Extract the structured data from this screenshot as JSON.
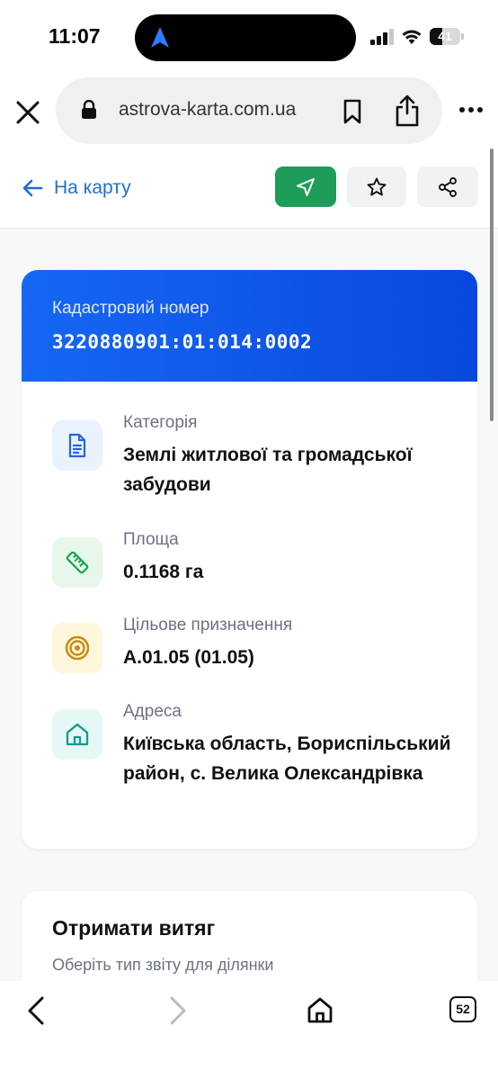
{
  "status_bar": {
    "time": "11:07",
    "battery_text": "41",
    "battery_level": 0.41
  },
  "browser": {
    "url": "astrova-karta.com.ua"
  },
  "page_header": {
    "back_label": "На карту"
  },
  "parcel": {
    "cadastral_label": "Кадастровий номер",
    "cadastral_number": "3220880901:01:014:0002",
    "fields": [
      {
        "label": "Категорія",
        "value": "Землі житлової та громадської забудови",
        "icon": "document-icon"
      },
      {
        "label": "Площа",
        "value": "0.1168 га",
        "icon": "ruler-icon"
      },
      {
        "label": "Цільове призначення",
        "value": "A.01.05 (01.05)",
        "icon": "target-icon"
      },
      {
        "label": "Адреса",
        "value": "Київська область, Бориспільський район, с. Велика Олександрівка",
        "icon": "home-icon"
      }
    ]
  },
  "extract": {
    "title": "Отримати витяг",
    "subtitle": "Оберіть тип звіту для ділянки"
  },
  "toolbar": {
    "tabs_count": "52"
  },
  "colors": {
    "accent_blue": "#1667f5",
    "nav_green": "#1d9d57",
    "link_blue": "#1f6fd1"
  }
}
